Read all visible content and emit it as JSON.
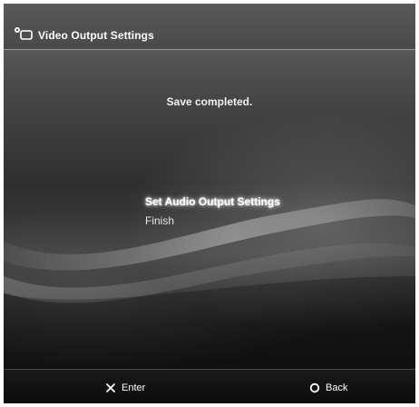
{
  "header": {
    "icon": "display-settings-icon",
    "title": "Video Output Settings"
  },
  "status": {
    "message": "Save completed."
  },
  "menu": {
    "items": [
      {
        "label": "Set Audio Output Settings",
        "selected": true
      },
      {
        "label": "Finish",
        "selected": false
      }
    ]
  },
  "footer": {
    "enter": {
      "icon": "cross-button-icon",
      "label": "Enter"
    },
    "back": {
      "icon": "circle-button-icon",
      "label": "Back"
    }
  },
  "colors": {
    "background_dark": "#0e0e0e",
    "header": "#494949",
    "text": "#ffffff"
  }
}
